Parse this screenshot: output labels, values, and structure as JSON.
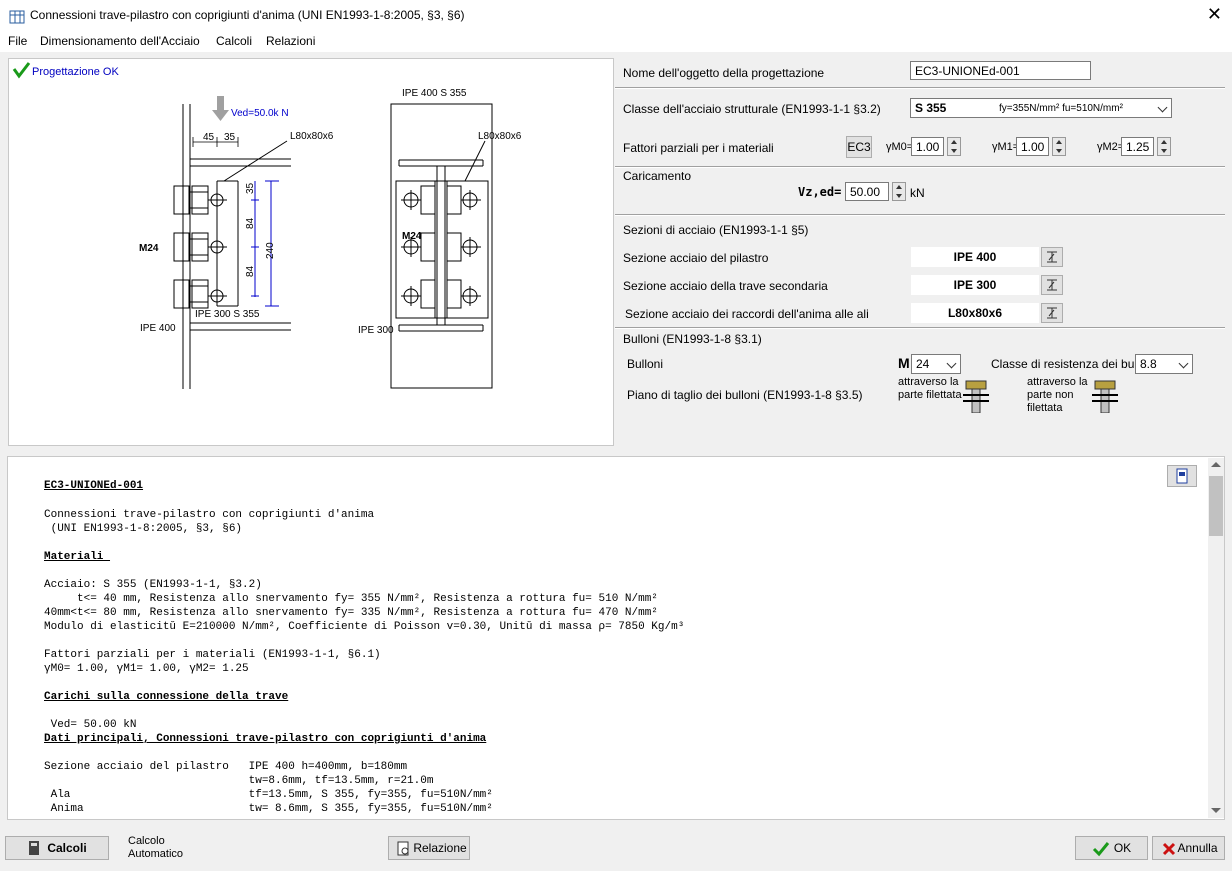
{
  "window": {
    "title": "Connessioni trave-pilastro con coprigiunti d'anima  (UNI EN1993-1-8:2005, §3, §6)",
    "close": "✕"
  },
  "menu": [
    "File",
    "Dimensionamento dell'Acciaio",
    "Calcoli",
    "Relazioni"
  ],
  "drawing": {
    "status": "Progettazione OK",
    "ved_label": "Ved=50.0k N",
    "left_angle": "L80x80x6",
    "right_angle": "L80x80x6",
    "right_title": "IPE 400 S 355",
    "dim_45": "45",
    "dim_35": "35",
    "dim_35v": "35",
    "dim_84a": "84",
    "dim_84b": "84",
    "dim_240": "240",
    "bolt_left": "M24",
    "bolt_right": "M24",
    "column_left": "IPE 400",
    "beam_left": "IPE 300 S 355",
    "beam_right": "IPE 300"
  },
  "form": {
    "name_label": "Nome dell'oggetto della progettazione",
    "name_value": "EC3-UNIONEd-001",
    "steel_label": "Classe dell'acciaio strutturale (EN1993-1-1 §3.2)",
    "steel_grade": "S 355",
    "steel_props": "fy=355N/mm² fu=510N/mm²",
    "factors_label": "Fattori parziali per i materiali",
    "ec3_button": "EC3",
    "gm0_label": "γM0=",
    "gm0": "1.00",
    "gm1_label": "γM1=",
    "gm1": "1.00",
    "gm2_label": "γM2=",
    "gm2": "1.25",
    "load_label": "Caricamento",
    "vz_label": "Vz,ed=",
    "vz": "50.00",
    "vz_unit": "kN",
    "sections_label": "Sezioni di acciaio (EN1993-1-1 §5)",
    "column_label": "Sezione acciaio del pilastro",
    "column_value": "IPE 400",
    "beam_label": "Sezione acciaio della trave secondaria",
    "beam_value": "IPE 300",
    "angle_label": "Sezione acciaio dei raccordi dell'anima alle ali",
    "angle_value": "L80x80x6",
    "bolts_section": "Bulloni (EN1993-1-8 §3.1)",
    "bolts_label": "Bulloni",
    "bolt_m": "M",
    "bolt_size": "24",
    "bolt_class_label": "Classe di resistenza dei bulloni",
    "bolt_class": "8.8",
    "shear_plane_label": "Piano di taglio dei bulloni (EN1993-1-8 §3.5)",
    "option1_line1": "attraverso la",
    "option1_line2": "parte filettata",
    "option2_line1": "attraverso la",
    "option2_line2": "parte non",
    "option2_line3": "filettata"
  },
  "report": {
    "lines": [
      "EC3-UNIONEd-001",
      "",
      "Connessioni trave-pilastro con coprigiunti d'anima",
      " (UNI EN1993-1-8:2005, §3, §6)",
      "",
      "Materiali ",
      "",
      "Acciaio: S 355 (EN1993-1-1, §3.2)",
      "     t<= 40 mm, Resistenza allo snervamento fy= 355 N/mm², Resistenza a rottura fu= 510 N/mm²",
      "40mm<t<= 80 mm, Resistenza allo snervamento fy= 335 N/mm², Resistenza a rottura fu= 470 N/mm²",
      "Modulo di elasticitŭ E=210000 N/mm², Coefficiente di Poisson v=0.30, Unitŭ di massa ρ= 7850 Kg/m³",
      "",
      "Fattori parziali per i materiali (EN1993-1-1, §6.1)",
      "γM0= 1.00, γM1= 1.00, γM2= 1.25",
      "",
      "Carichi sulla connessione della trave",
      "",
      " Ved= 50.00 kN",
      "Dati principali, Connessioni trave-pilastro con coprigiunti d'anima",
      "",
      "Sezione acciaio del pilastro   IPE 400 h=400mm, b=180mm",
      "                               tw=8.6mm, tf=13.5mm, r=21.0m",
      " Ala                           tf=13.5mm, S 355, fy=355, fu=510N/mm²",
      " Anima                         tw= 8.6mm, S 355, fy=355, fu=510N/mm²"
    ]
  },
  "bottom": {
    "calc_button": "Calcoli",
    "auto_line1": "Calcolo",
    "auto_line2": "Automatico",
    "report_button": "Relazione",
    "ok_button": "OK",
    "cancel_button": "Annulla"
  }
}
